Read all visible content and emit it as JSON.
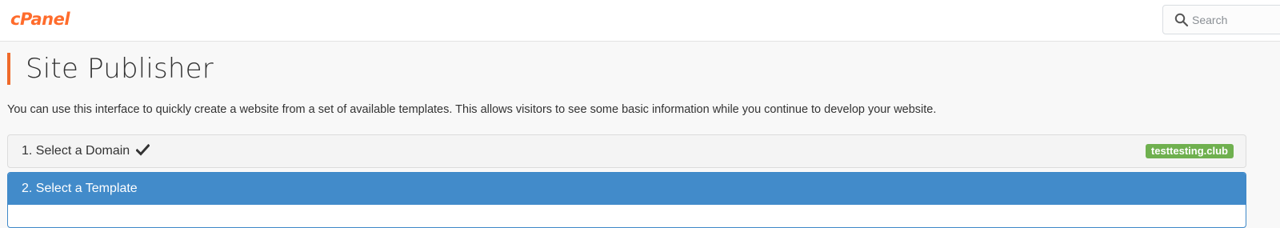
{
  "header": {
    "logo_text": "cPanel",
    "brand_color": "#ff6c2c",
    "search": {
      "placeholder": "Search",
      "icon": "search-icon"
    }
  },
  "page": {
    "title": "Site Publisher",
    "description": "You can use this interface to quickly create a website from a set of available templates. This allows visitors to see some basic information while you continue to develop your website."
  },
  "steps": [
    {
      "label": "1. Select a Domain",
      "status_icon": "check-icon",
      "selected_value": "testtesting.club",
      "badge_color": "#6fb04f"
    },
    {
      "label": "2. Select a Template",
      "active": true,
      "header_color": "#428bca"
    }
  ]
}
